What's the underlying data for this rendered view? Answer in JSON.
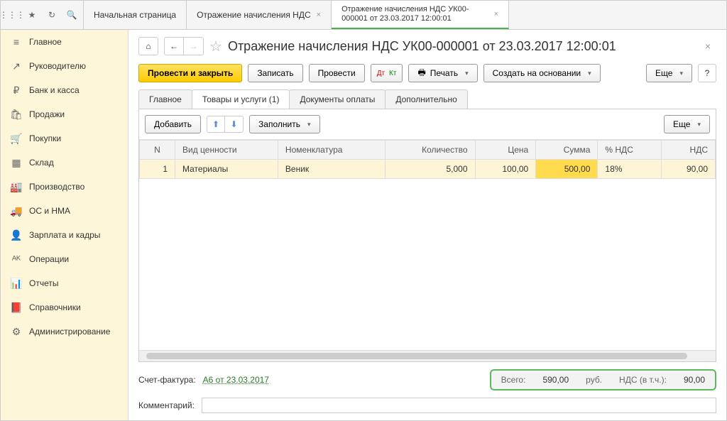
{
  "tabs": [
    {
      "label": "Начальная страница"
    },
    {
      "label": "Отражение начисления НДС"
    },
    {
      "label": "Отражение начисления НДС УК00-000001 от 23.03.2017 12:00:01"
    }
  ],
  "sidebar": {
    "items": [
      {
        "icon": "≡",
        "label": "Главное"
      },
      {
        "icon": "↗",
        "label": "Руководителю"
      },
      {
        "icon": "₽",
        "label": "Банк и касса"
      },
      {
        "icon": "🛍",
        "label": "Продажи"
      },
      {
        "icon": "🛒",
        "label": "Покупки"
      },
      {
        "icon": "▦",
        "label": "Склад"
      },
      {
        "icon": "🏭",
        "label": "Производство"
      },
      {
        "icon": "🚚",
        "label": "ОС и НМА"
      },
      {
        "icon": "👤",
        "label": "Зарплата и кадры"
      },
      {
        "icon": "ᴬᴷ",
        "label": "Операции"
      },
      {
        "icon": "📊",
        "label": "Отчеты"
      },
      {
        "icon": "📕",
        "label": "Справочники"
      },
      {
        "icon": "⚙",
        "label": "Администрирование"
      }
    ]
  },
  "doc": {
    "title": "Отражение начисления НДС УК00-000001 от 23.03.2017 12:00:01",
    "toolbar": {
      "post_close": "Провести и закрыть",
      "save": "Записать",
      "post": "Провести",
      "print": "Печать",
      "create_based": "Создать на основании",
      "more": "Еще"
    },
    "doc_tabs": [
      "Главное",
      "Товары и услуги (1)",
      "Документы оплаты",
      "Дополнительно"
    ],
    "sub_toolbar": {
      "add": "Добавить",
      "fill": "Заполнить",
      "more": "Еще"
    },
    "grid": {
      "headers": [
        "N",
        "Вид ценности",
        "Номенклатура",
        "Количество",
        "Цена",
        "Сумма",
        "% НДС",
        "НДС"
      ],
      "row": {
        "n": "1",
        "type": "Материалы",
        "item": "Веник",
        "qty": "5,000",
        "price": "100,00",
        "sum": "500,00",
        "vat_rate": "18%",
        "vat": "90,00"
      }
    },
    "footer": {
      "invoice_label": "Счет-фактура:",
      "invoice_link": "А6 от 23.03.2017",
      "total_label": "Всего:",
      "total_value": "590,00",
      "currency": "руб.",
      "vat_label": "НДС (в т.ч.):",
      "vat_value": "90,00",
      "comment_label": "Комментарий:"
    }
  }
}
